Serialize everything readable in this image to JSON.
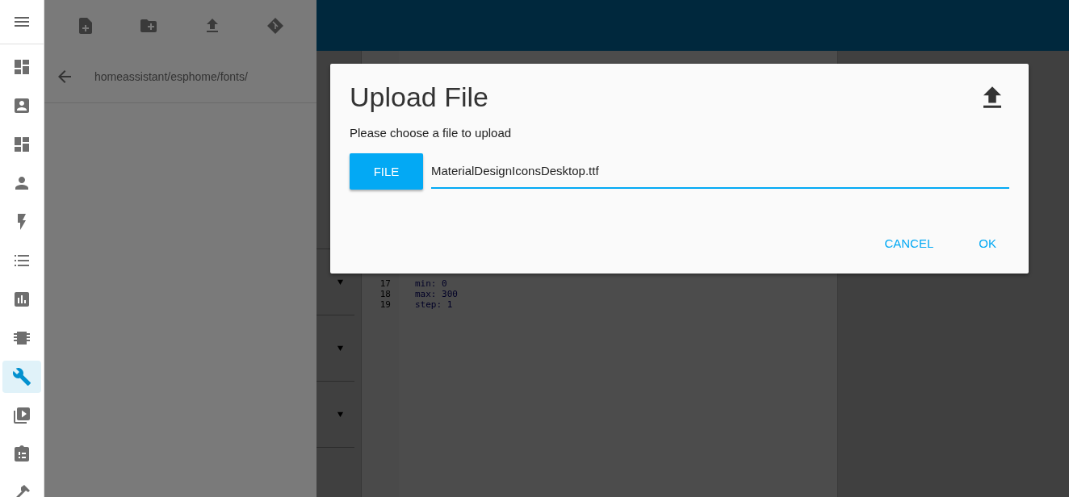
{
  "sidebar": {
    "items": [
      {
        "kind": "dashboard",
        "selected": false
      },
      {
        "kind": "account-box",
        "selected": false
      },
      {
        "kind": "dashboard",
        "selected": false
      },
      {
        "kind": "person",
        "selected": false
      },
      {
        "kind": "flash",
        "selected": false
      },
      {
        "kind": "list",
        "selected": false
      },
      {
        "kind": "chart",
        "selected": false
      },
      {
        "kind": "chip",
        "selected": false
      },
      {
        "kind": "wrench",
        "selected": true
      },
      {
        "kind": "video",
        "selected": false
      },
      {
        "kind": "clipboard",
        "selected": false
      },
      {
        "kind": "hammer",
        "selected": false
      }
    ]
  },
  "file_browser": {
    "path": "homeassistant/esphome/fonts/"
  },
  "editor": {
    "lines": [
      {
        "number": "17",
        "code": "min: 0"
      },
      {
        "number": "18",
        "code": "max: 300"
      },
      {
        "number": "19",
        "code": "step: 1"
      }
    ]
  },
  "dialog": {
    "title": "Upload File",
    "message": "Please choose a file to upload",
    "file_button": "FILE",
    "file_name": "MaterialDesignIconsDesktop.ttf",
    "actions": [
      "CANCEL",
      "OK"
    ]
  }
}
